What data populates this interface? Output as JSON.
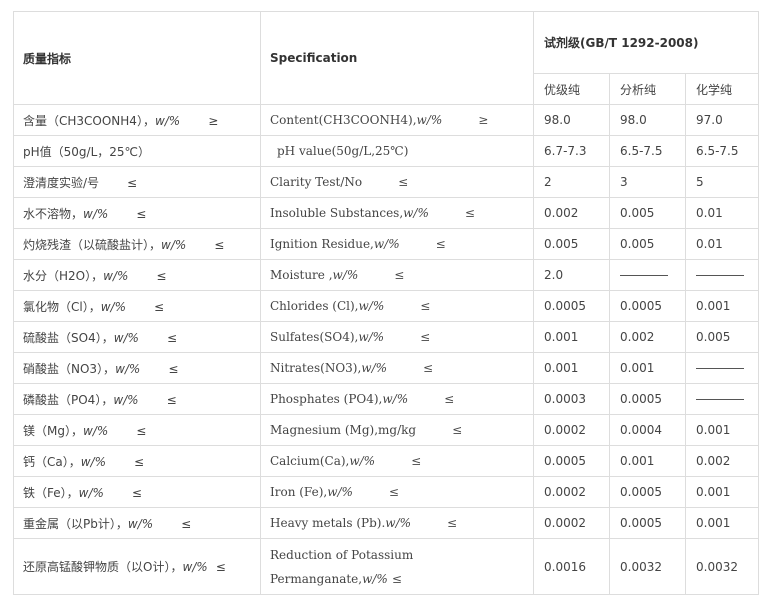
{
  "header": {
    "quality_col": "质量指标",
    "spec_col": "Specification",
    "grade_title": "试剂级(GB/T 1292-2008)",
    "grades": [
      "优级纯",
      "分析纯",
      "化学纯"
    ]
  },
  "rows": [
    {
      "cn": "含量（CH3COONH4），",
      "cn_unit": "w/%",
      "cn_op": "≥",
      "en": "Content(CH3COONH4),",
      "en_unit": "w/%",
      "en_op": "≥",
      "v1": "98.0",
      "v2": "98.0",
      "v3": "97.0"
    },
    {
      "cn": "pH值（50g/L，25℃）",
      "cn_unit": "",
      "cn_op": "",
      "en": "pH value(50g/L,25℃)",
      "en_unit": "",
      "en_op": "",
      "v1": "6.7-7.3",
      "v2": "6.5-7.5",
      "v3": "6.5-7.5"
    },
    {
      "cn": "澄清度实验/号",
      "cn_unit": "",
      "cn_op": "≤",
      "en": "Clarity Test/No",
      "en_unit": "",
      "en_op": "≤",
      "v1": "2",
      "v2": "3",
      "v3": "5"
    },
    {
      "cn": "水不溶物，",
      "cn_unit": "w/%",
      "cn_op": "≤",
      "en": "Insoluble Substances,",
      "en_unit": "w/%",
      "en_op": "≤",
      "v1": "0.002",
      "v2": "0.005",
      "v3": "0.01"
    },
    {
      "cn": "灼烧残渣（以硫酸盐计），",
      "cn_unit": "w/%",
      "cn_op": "≤",
      "en": "Ignition Residue,",
      "en_unit": "w/%",
      "en_op": "≤",
      "v1": "0.005",
      "v2": "0.005",
      "v3": "0.01"
    },
    {
      "cn": "水分（H2O），",
      "cn_unit": "w/%",
      "cn_op": "≤",
      "en": "Moisture ,",
      "en_unit": "w/%",
      "en_op": "≤",
      "v1": "2.0",
      "v2": "—",
      "v3": "—"
    },
    {
      "cn": "氯化物（Cl），",
      "cn_unit": "w/%",
      "cn_op": "≤",
      "en": "Chlorides (Cl),",
      "en_unit": "w/%",
      "en_op": "≤",
      "v1": "0.0005",
      "v2": "0.0005",
      "v3": "0.001"
    },
    {
      "cn": "硫酸盐（SO4），",
      "cn_unit": "w/%",
      "cn_op": "≤",
      "en": "Sulfates(SO4),",
      "en_unit": "w/%",
      "en_op": "≤",
      "v1": "0.001",
      "v2": "0.002",
      "v3": "0.005"
    },
    {
      "cn": "硝酸盐（NO3），",
      "cn_unit": "w/%",
      "cn_op": "≤",
      "en": "Nitrates(NO3),",
      "en_unit": "w/%",
      "en_op": "≤",
      "v1": "0.001",
      "v2": "0.001",
      "v3": "—"
    },
    {
      "cn": "磷酸盐（PO4），",
      "cn_unit": "w/%",
      "cn_op": "≤",
      "en": "Phosphates (PO4),",
      "en_unit": "w/%",
      "en_op": "≤",
      "v1": "0.0003",
      "v2": "0.0005",
      "v3": "—"
    },
    {
      "cn": "镁（Mg），",
      "cn_unit": "w/%",
      "cn_op": "≤",
      "en": "Magnesium (Mg),mg/kg",
      "en_unit": "",
      "en_op": "≤",
      "v1": "0.0002",
      "v2": "0.0004",
      "v3": "0.001"
    },
    {
      "cn": "钙（Ca），",
      "cn_unit": "w/%",
      "cn_op": "≤",
      "en": "Calcium(Ca),",
      "en_unit": "w/%",
      "en_op": "≤",
      "v1": "0.0005",
      "v2": "0.001",
      "v3": "0.002"
    },
    {
      "cn": "铁（Fe），",
      "cn_unit": "w/%",
      "cn_op": "≤",
      "en": "Iron (Fe),",
      "en_unit": "w/%",
      "en_op": "≤",
      "v1": "0.0002",
      "v2": "0.0005",
      "v3": "0.001"
    },
    {
      "cn": "重金属（以Pb计），",
      "cn_unit": "w/%",
      "cn_op": "≤",
      "en": "Heavy metals (Pb).",
      "en_unit": "w/%",
      "en_op": "≤",
      "v1": "0.0002",
      "v2": "0.0005",
      "v3": "0.001"
    }
  ],
  "last_row": {
    "cn": "还原高锰酸钾物质（以O计），",
    "cn_unit": "w/%",
    "cn_op": "≤",
    "en_line1": "Reduction of Potassium",
    "en_line2": "Permanganate,",
    "en_unit": "w/%",
    "en_op": "≤",
    "v1": "0.0016",
    "v2": "0.0032",
    "v3": "0.0032"
  }
}
